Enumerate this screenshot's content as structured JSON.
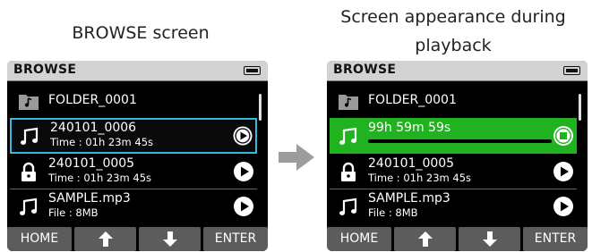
{
  "captions": {
    "left": "BROWSE screen",
    "right_line1": "Screen appearance during",
    "right_line2": "playback"
  },
  "arrow": {
    "color": "#9c9c9c"
  },
  "colors": {
    "selection_border": "#35b7df",
    "playing_row": "#21b21f",
    "key_bg": "#5c5c5c",
    "title_bar": "#d2d2d2"
  },
  "left_screen": {
    "title": "BROWSE",
    "rows": [
      {
        "icon": "folder-icon",
        "name": "FOLDER_0001"
      },
      {
        "icon": "music-note-icon",
        "name": "240101_0006",
        "sub": "Time : 01h 23m 45s",
        "action_icon": "play-icon",
        "selected": true
      },
      {
        "icon": "lock-icon",
        "name": "240101_0005",
        "sub": "Time : 01h 23m 45s",
        "action_icon": "play-icon"
      },
      {
        "icon": "music-note-icon",
        "name": "SAMPLE.mp3",
        "sub": "File : 8MB",
        "action_icon": "play-icon"
      }
    ],
    "keys": {
      "home": "HOME",
      "enter": "ENTER",
      "up_icon": "arrow-up-icon",
      "down_icon": "arrow-down-icon"
    }
  },
  "right_screen": {
    "title": "BROWSE",
    "rows": [
      {
        "icon": "folder-icon",
        "name": "FOLDER_0001"
      },
      {
        "icon": "music-note-icon",
        "name": "99h 59m 59s",
        "action_icon": "stop-icon",
        "playing": true
      },
      {
        "icon": "lock-icon",
        "name": "240101_0005",
        "sub": "Time : 01h 23m 45s",
        "action_icon": "play-icon"
      },
      {
        "icon": "music-note-icon",
        "name": "SAMPLE.mp3",
        "sub": "File : 8MB",
        "action_icon": "play-icon"
      }
    ],
    "keys": {
      "home": "HOME",
      "enter": "ENTER",
      "up_icon": "arrow-up-icon",
      "down_icon": "arrow-down-icon"
    }
  }
}
